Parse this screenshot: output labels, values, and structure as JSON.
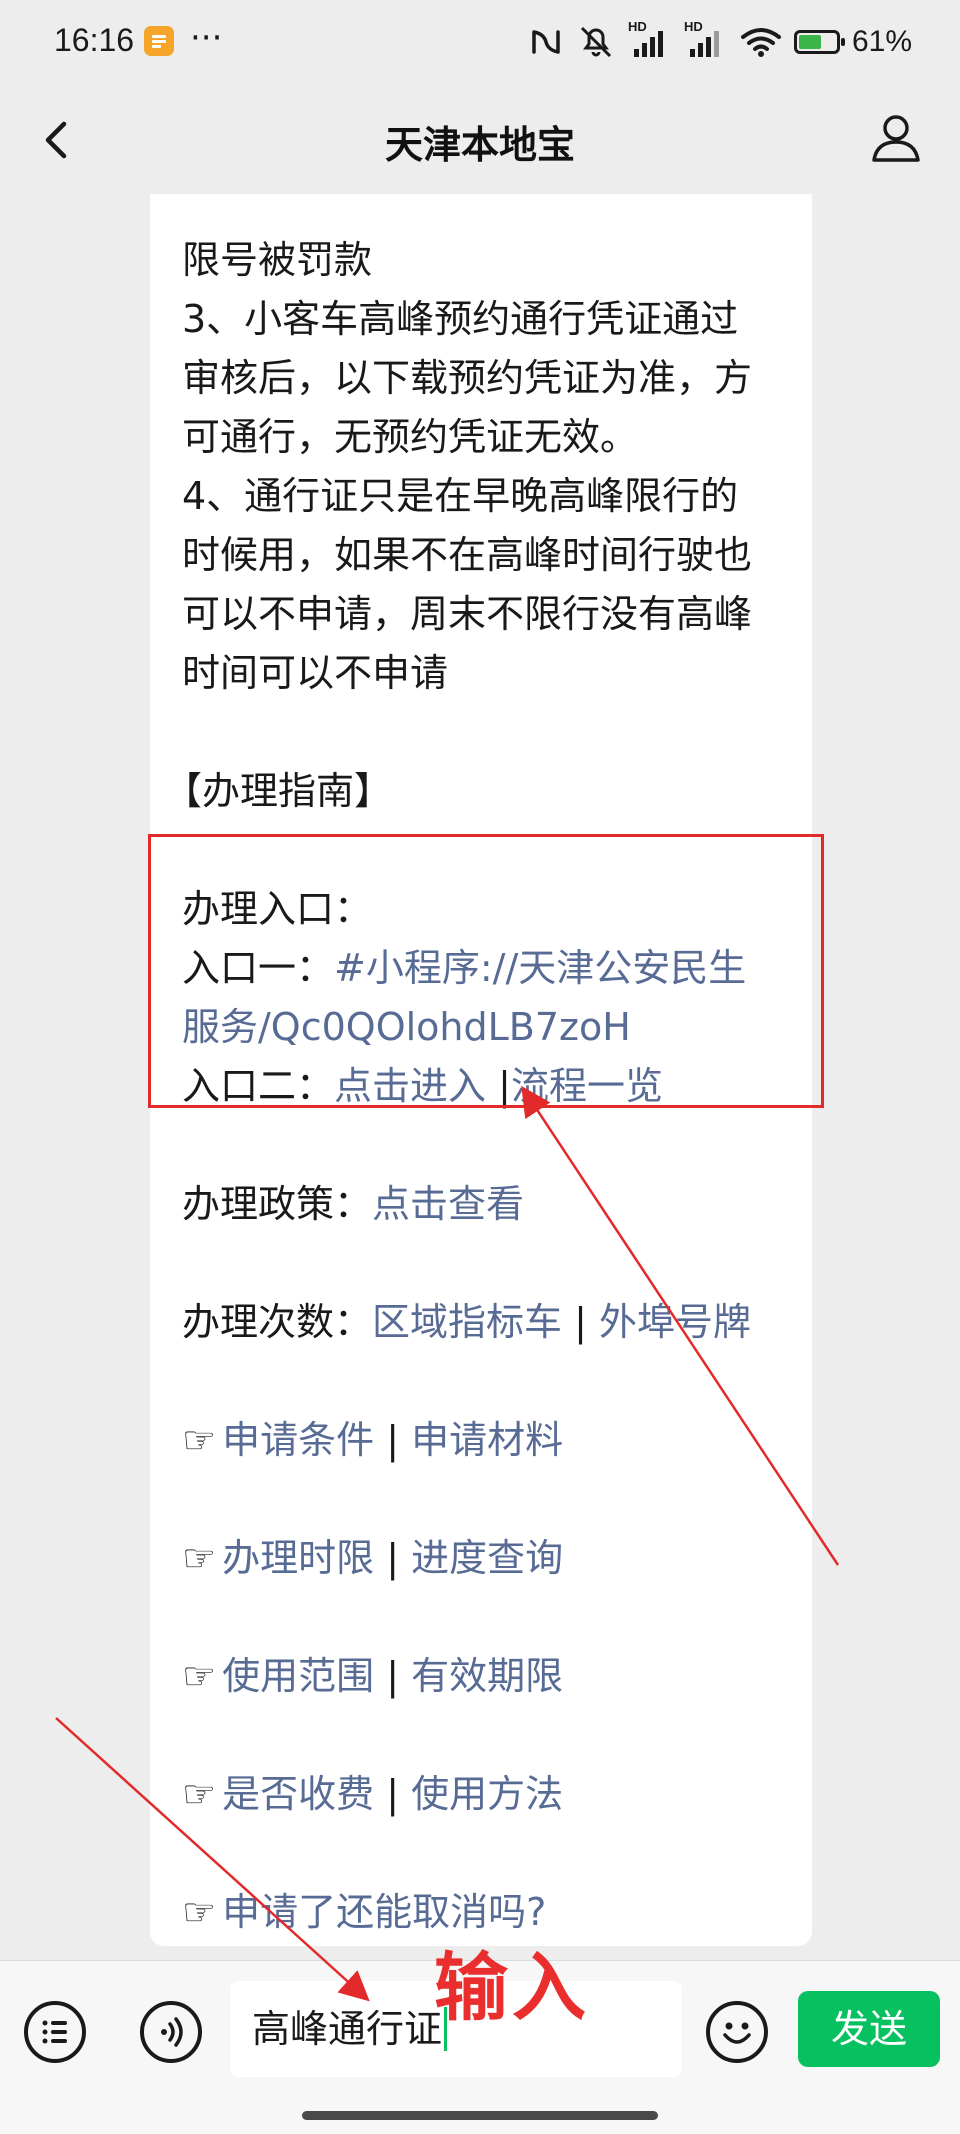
{
  "status_bar": {
    "time": "16:16",
    "dots": "···",
    "battery_text": "61%",
    "battery_level": 0.61,
    "icons": [
      "nfc-icon",
      "mute-icon",
      "signal-icon",
      "signal-icon",
      "wifi-icon",
      "battery-icon"
    ],
    "network_labels": [
      "HD",
      "HD"
    ]
  },
  "header": {
    "title": "天津本地宝",
    "back_icon": "chevron-left-icon",
    "profile_icon": "user-icon"
  },
  "message": {
    "intro_lines": [
      "限号被罚款",
      "3、小客车高峰预约通行凭证通过",
      "审核后，以下载预约凭证为准，方",
      "可通行，无预约凭证无效。",
      "4、通行证只是在早晚高峰限行的",
      "时候用，如果不在高峰时间行驶也",
      "可以不申请，周末不限行没有高峰",
      "时间可以不申请"
    ],
    "section_title": "【办理指南】",
    "entry_title": "办理入口：",
    "entry1_label": "入口一：",
    "entry1_link_line1": "#小程序://天津公安民生",
    "entry1_link_line2": "服务/Qc0QOlohdLB7zoH",
    "entry2_label": "入口二：",
    "entry2_link_a": "点击进入",
    "entry2_link_b": "流程一览",
    "policy_label": "办理政策：",
    "policy_link": "点击查看",
    "count_label": "办理次数：",
    "count_link_a": "区域指标车",
    "count_link_b": "外埠号牌",
    "hand_glyph": "☞",
    "separator": "|",
    "link_rows": [
      [
        "申请条件",
        "申请材料"
      ],
      [
        "办理时限",
        "进度查询"
      ],
      [
        "使用范围",
        "有效期限"
      ],
      [
        "是否收费",
        "使用方法"
      ]
    ],
    "last_link": "申请了还能取消吗?"
  },
  "annotation": {
    "label": "输入",
    "color": "#ea2e2e"
  },
  "bottom_bar": {
    "input_value": "高峰通行证",
    "send_label": "发送",
    "menu_icon": "list-icon",
    "voice_icon": "voice-icon",
    "emoji_icon": "emoji-icon"
  },
  "colors": {
    "link": "#576b95",
    "send_button": "#07c160",
    "background": "#ededed"
  }
}
